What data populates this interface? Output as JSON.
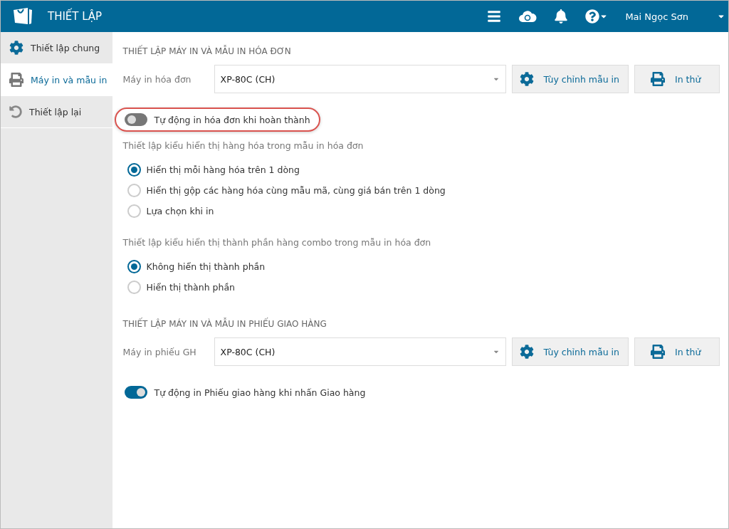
{
  "header": {
    "title": "THIẾT LẬP",
    "user": "Mai Ngọc Sơn"
  },
  "sidebar": {
    "items": [
      {
        "label": "Thiết lập chung",
        "selected": false
      },
      {
        "label": "Máy in và mẫu in",
        "selected": true
      },
      {
        "label": "Thiết lập lại",
        "selected": false
      }
    ]
  },
  "sections": [
    {
      "title": "THIẾT LẬP MÁY IN VÀ MẪU IN HÓA ĐƠN",
      "printer_label": "Máy in hóa đơn",
      "printer_value": "XP-80C (CH)",
      "customize_button": "Tùy chỉnh mẫu in",
      "test_button": "In thử",
      "toggle": {
        "label": "Tự động in hóa đơn khi hoàn thành",
        "on": false,
        "highlighted": true
      },
      "groups": [
        {
          "title": "Thiết lập kiểu hiển thị hàng hóa trong mẫu in hóa đơn",
          "options": [
            {
              "label": "Hiển thị mỗi hàng hóa trên 1 dòng",
              "selected": true
            },
            {
              "label": "Hiển thị gộp các hàng hóa cùng mẫu mã, cùng giá bán trên 1 dòng",
              "selected": false
            },
            {
              "label": "Lựa chọn khi in",
              "selected": false
            }
          ]
        },
        {
          "title": "Thiết lập kiểu hiển thị thành phần hàng combo trong mẫu in hóa đơn",
          "options": [
            {
              "label": "Không hiển thị thành phần",
              "selected": true
            },
            {
              "label": "Hiển thị thành phần",
              "selected": false
            }
          ]
        }
      ]
    },
    {
      "title": "THIẾT LẬP MÁY IN VÀ MẪU IN PHIẾU GIAO HÀNG",
      "printer_label": "Máy in phiếu GH",
      "printer_value": "XP-80C (CH)",
      "customize_button": "Tùy chỉnh mẫu in",
      "test_button": "In thử",
      "toggle": {
        "label": "Tự động in Phiếu giao hàng khi nhấn Giao hàng",
        "on": true,
        "highlighted": false
      }
    }
  ]
}
